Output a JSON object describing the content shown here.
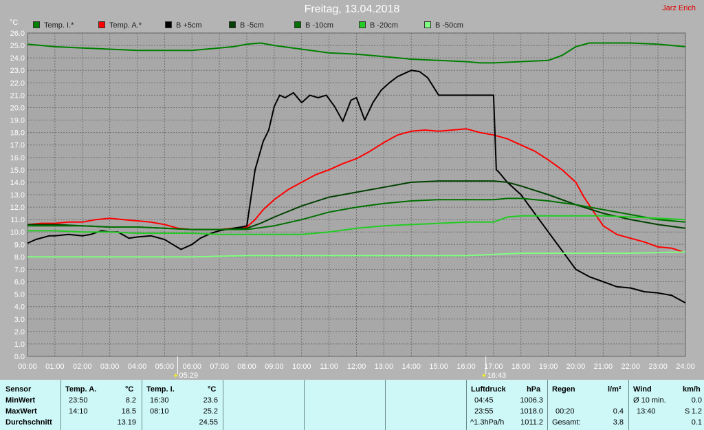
{
  "header": {
    "title": "Freitag, 13.04.2018",
    "author": "Jarz Erich"
  },
  "chart_data": {
    "type": "line",
    "title": "Freitag, 13.04.2018",
    "ylabel": "°C",
    "ylim": [
      0,
      26
    ],
    "xlim": [
      0,
      24
    ],
    "y_ticks": [
      "0.0",
      "1.0",
      "2.0",
      "3.0",
      "4.0",
      "5.0",
      "6.0",
      "7.0",
      "8.0",
      "9.0",
      "10.0",
      "11.0",
      "12.0",
      "13.0",
      "14.0",
      "15.0",
      "16.0",
      "17.0",
      "18.0",
      "19.0",
      "20.0",
      "21.0",
      "22.0",
      "23.0",
      "24.0",
      "25.0",
      "26.0"
    ],
    "x_ticks": [
      "00:00",
      "01:00",
      "02:00",
      "03:00",
      "04:00",
      "05:00",
      "06:00",
      "07:00",
      "08:00",
      "09:00",
      "10:00",
      "11:00",
      "12:00",
      "13:00",
      "14:00",
      "15:00",
      "16:00",
      "17:00",
      "18:00",
      "19:00",
      "20:00",
      "21:00",
      "22:00",
      "23:00",
      "24:00"
    ],
    "grid": true,
    "legend_position": "top",
    "sunrise": {
      "x": 5.48,
      "label": "05:29"
    },
    "sunset": {
      "x": 16.72,
      "label": "16:43"
    },
    "series": [
      {
        "name": "Temp. I.*",
        "color": "#008000",
        "width": 2,
        "x": [
          0,
          1,
          2,
          3,
          4,
          5,
          6,
          7,
          7.5,
          8,
          8.5,
          9,
          10,
          11,
          12,
          13,
          14,
          15,
          16,
          16.5,
          17,
          18,
          19,
          19.5,
          20,
          20.5,
          21,
          22,
          23,
          24
        ],
        "y": [
          25.1,
          24.9,
          24.8,
          24.7,
          24.6,
          24.6,
          24.6,
          24.8,
          24.9,
          25.1,
          25.2,
          25.0,
          24.7,
          24.4,
          24.3,
          24.1,
          23.9,
          23.8,
          23.7,
          23.6,
          23.6,
          23.7,
          23.8,
          24.2,
          24.9,
          25.2,
          25.2,
          25.2,
          25.1,
          24.9
        ]
      },
      {
        "name": "Temp. A.*",
        "color": "#ff0000",
        "width": 2,
        "x": [
          0,
          0.5,
          1,
          1.5,
          2,
          2.5,
          3,
          3.5,
          4,
          4.5,
          5,
          5.5,
          6,
          6.5,
          7,
          7.5,
          8,
          8.3,
          8.6,
          9,
          9.5,
          10,
          10.5,
          11,
          11.5,
          12,
          12.5,
          13,
          13.5,
          14,
          14.5,
          15,
          15.5,
          16,
          16.5,
          17,
          17.5,
          18,
          18.5,
          19,
          19.5,
          20,
          20.3,
          20.6,
          21,
          21.5,
          22,
          22.5,
          23,
          23.5,
          23.9
        ],
        "y": [
          10.6,
          10.7,
          10.7,
          10.8,
          10.8,
          11.0,
          11.1,
          11.0,
          10.9,
          10.8,
          10.6,
          10.3,
          10.2,
          10.2,
          10.2,
          10.3,
          10.4,
          11.0,
          11.8,
          12.6,
          13.4,
          14.0,
          14.6,
          15.0,
          15.5,
          15.9,
          16.5,
          17.2,
          17.8,
          18.1,
          18.2,
          18.1,
          18.2,
          18.3,
          18.0,
          17.8,
          17.5,
          17.0,
          16.5,
          15.8,
          15.0,
          14.0,
          12.8,
          11.8,
          10.5,
          9.8,
          9.5,
          9.2,
          8.8,
          8.7,
          8.4
        ]
      },
      {
        "name": "B +5cm",
        "color": "#000000",
        "width": 2,
        "x": [
          0,
          0.3,
          0.8,
          1,
          1.5,
          2,
          2.3,
          2.7,
          3,
          3.3,
          3.7,
          4,
          4.5,
          5,
          5.3,
          5.6,
          6,
          6.3,
          6.7,
          7,
          7.5,
          7.8,
          8,
          8.1,
          8.3,
          8.6,
          8.8,
          9,
          9.2,
          9.4,
          9.7,
          10,
          10.3,
          10.6,
          10.9,
          11.2,
          11.5,
          11.8,
          12,
          12.3,
          12.6,
          12.9,
          13.2,
          13.5,
          13.8,
          14,
          14.3,
          14.6,
          15,
          15.5,
          16,
          16.5,
          17,
          17.1,
          17.2,
          17.5,
          18,
          18.5,
          19,
          19.5,
          20,
          20.5,
          21,
          21.5,
          22,
          22.5,
          23,
          23.5,
          24
        ],
        "y": [
          9.1,
          9.4,
          9.7,
          9.7,
          9.8,
          9.7,
          9.8,
          10.1,
          10.0,
          10.0,
          9.5,
          9.6,
          9.7,
          9.4,
          9.0,
          8.6,
          9.0,
          9.5,
          9.9,
          10.1,
          10.3,
          10.4,
          10.5,
          12.0,
          15.0,
          17.3,
          18.2,
          20.1,
          21.0,
          20.8,
          21.2,
          20.4,
          21.0,
          20.8,
          21.0,
          20.1,
          18.9,
          20.6,
          20.8,
          19.0,
          20.4,
          21.4,
          22.0,
          22.5,
          22.8,
          23.0,
          22.9,
          22.4,
          21.0,
          21.0,
          21.0,
          21.0,
          21.0,
          15.0,
          14.8,
          14.0,
          13.0,
          11.5,
          10.0,
          8.5,
          7.0,
          6.4,
          6.0,
          5.6,
          5.5,
          5.2,
          5.1,
          4.9,
          4.3
        ]
      },
      {
        "name": "B -5cm",
        "color": "#004000",
        "width": 2,
        "x": [
          0,
          1,
          2,
          3,
          4,
          5,
          6,
          7,
          8,
          8.5,
          9,
          10,
          11,
          12,
          13,
          14,
          15,
          16,
          17,
          17.5,
          18,
          19,
          20,
          21,
          22,
          23,
          24
        ],
        "y": [
          10.6,
          10.6,
          10.5,
          10.4,
          10.4,
          10.3,
          10.2,
          10.2,
          10.3,
          10.7,
          11.2,
          12.1,
          12.8,
          13.2,
          13.6,
          14.0,
          14.1,
          14.1,
          14.1,
          14.0,
          13.7,
          13.0,
          12.2,
          11.5,
          11.0,
          10.6,
          10.3
        ]
      },
      {
        "name": "B -10cm",
        "color": "#007000",
        "width": 2,
        "x": [
          0,
          1,
          2,
          3,
          4,
          5,
          6,
          7,
          8,
          9,
          10,
          11,
          12,
          13,
          14,
          15,
          16,
          17,
          17.5,
          18,
          19,
          20,
          21,
          22,
          23,
          24
        ],
        "y": [
          10.5,
          10.5,
          10.5,
          10.4,
          10.4,
          10.3,
          10.2,
          10.2,
          10.2,
          10.5,
          11.0,
          11.6,
          12.0,
          12.3,
          12.5,
          12.6,
          12.6,
          12.6,
          12.7,
          12.7,
          12.5,
          12.2,
          11.8,
          11.4,
          11.0,
          10.8
        ]
      },
      {
        "name": "B -20cm",
        "color": "#22cc22",
        "width": 2,
        "x": [
          0,
          1,
          2,
          3,
          4,
          5,
          6,
          7,
          8,
          9,
          10,
          11,
          12,
          13,
          14,
          15,
          16,
          17,
          17.5,
          18,
          19,
          20,
          21,
          22,
          23,
          24
        ],
        "y": [
          10.1,
          10.1,
          10.0,
          10.0,
          9.9,
          9.9,
          9.9,
          9.8,
          9.8,
          9.8,
          9.8,
          10.0,
          10.3,
          10.5,
          10.6,
          10.7,
          10.8,
          10.8,
          11.2,
          11.3,
          11.3,
          11.3,
          11.3,
          11.2,
          11.1,
          11.0
        ]
      },
      {
        "name": "B -50cm",
        "color": "#80ff80",
        "width": 2,
        "x": [
          0,
          2,
          4,
          6,
          8,
          10,
          12,
          14,
          16,
          17,
          18,
          20,
          22,
          24
        ],
        "y": [
          8.0,
          8.0,
          8.0,
          8.0,
          8.1,
          8.1,
          8.1,
          8.1,
          8.1,
          8.2,
          8.3,
          8.3,
          8.3,
          8.4
        ]
      }
    ]
  },
  "summary": {
    "sensor": {
      "label": "Sensor",
      "rows": [
        "MinWert",
        "MaxWert",
        "Durchschnitt"
      ]
    },
    "temp_a": {
      "label": "Temp. A.",
      "unit": "°C",
      "min_time": "23:50",
      "min": "8.2",
      "max_time": "14:10",
      "max": "18.5",
      "avg": "13.19"
    },
    "temp_i": {
      "label": "Temp. I.",
      "unit": "°C",
      "min_time": "16:30",
      "min": "23.6",
      "max_time": "08:10",
      "max": "25.2",
      "avg": "24.55"
    },
    "luftdruck": {
      "label": "Luftdruck",
      "unit": "hPa",
      "min_time": "04:45",
      "min": "1006.3",
      "max_time": "23:55",
      "max": "1018.0",
      "trend_label": "^1.3hPa/h",
      "trend": "1011.2"
    },
    "regen": {
      "label": "Regen",
      "unit": "l/m²",
      "time": "00:20",
      "value": "0.4",
      "total_label": "Gesamt:",
      "total": "3.8"
    },
    "wind": {
      "label": "Wind",
      "unit": "km/h",
      "avg_label": "Ø 10 min.",
      "avg": "0.0",
      "max_time": "13:40",
      "max_dir": "S",
      "max": "1.2",
      "extra": "0.1"
    }
  }
}
